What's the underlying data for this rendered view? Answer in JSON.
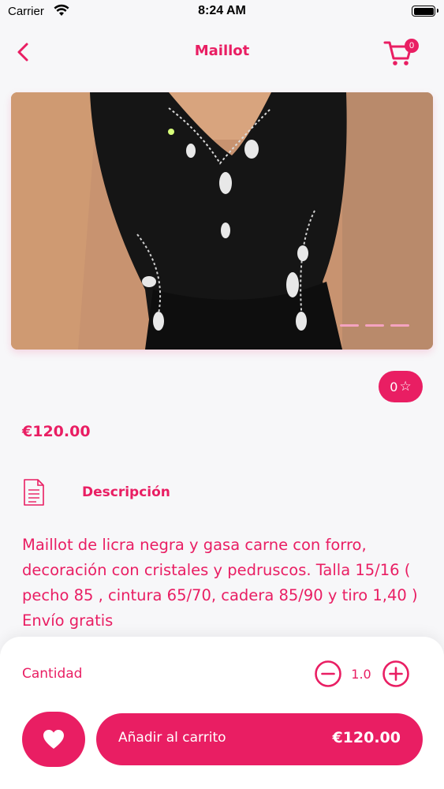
{
  "status_bar": {
    "carrier": "Carrier",
    "time": "8:24 AM"
  },
  "nav": {
    "title": "Maillot",
    "cart_count": "0",
    "back_icon": "chevron-left-icon",
    "cart_icon": "shopping-cart-icon"
  },
  "product": {
    "rating": "0",
    "price": "€120.00",
    "description_heading": "Descripción",
    "description": "Maillot de licra negra y gasa carne con forro, decoración con cristales y pedruscos. Talla 15/16 ( pecho 85 , cintura 65/70, cadera 85/90 y tiro 1,40 ) Envío gratis"
  },
  "cart_panel": {
    "quantity_label": "Cantidad",
    "quantity_value": "1.0",
    "add_to_cart_label": "Añadir al carrito",
    "add_to_cart_price": "€120.00"
  },
  "colors": {
    "accent": "#e91e63",
    "background": "#f7f7f9"
  }
}
